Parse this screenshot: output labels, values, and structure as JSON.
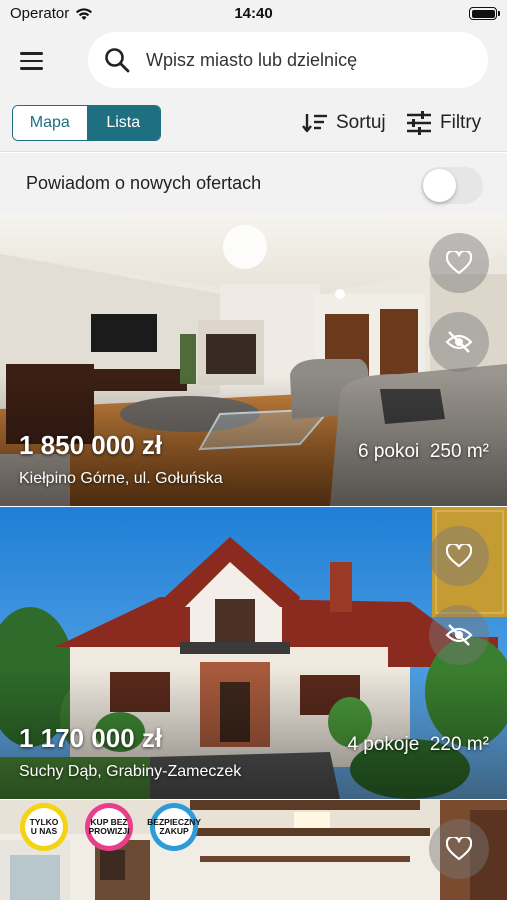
{
  "status_bar": {
    "carrier": "Operator",
    "time": "14:40"
  },
  "search": {
    "placeholder": "Wpisz miasto lub dzielnicę"
  },
  "view_toggle": {
    "map_label": "Mapa",
    "list_label": "Lista",
    "selected": "Lista"
  },
  "toolbar": {
    "sort_label": "Sortuj",
    "filter_label": "Filtry"
  },
  "notifications": {
    "label": "Powiadom o nowych ofertach",
    "enabled": false
  },
  "listings": [
    {
      "price": "1 850 000 zł",
      "rooms": "6 pokoi",
      "area": "250 m²",
      "address": "Kiełpino Górne, ul. Gołuńska"
    },
    {
      "price": "1 170 000 zł",
      "rooms": "4 pokoje",
      "area": "220 m²",
      "address": "Suchy Dąb, Grabiny-Zameczek"
    },
    {
      "badges": [
        "TYLKO U NAS",
        "KUP BEZ PROWIZJI",
        "BEZPIECZNY ZAKUP"
      ]
    }
  ],
  "colors": {
    "accent": "#1e6f80",
    "toggle_off": "#e6e6e6"
  }
}
